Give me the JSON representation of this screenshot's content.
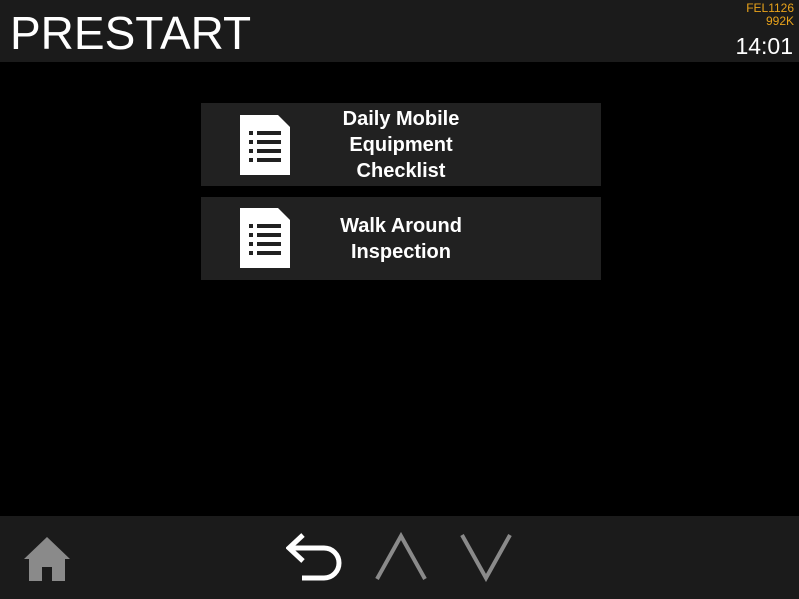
{
  "header": {
    "title": "PRESTART",
    "unit_id": "FEL1126",
    "unit_code": "992K",
    "time": "14:01"
  },
  "menu": {
    "items": [
      {
        "label_lines": [
          "Daily Mobile",
          "Equipment",
          "Checklist"
        ],
        "icon": "document-list-icon"
      },
      {
        "label_lines": [
          "Walk Around",
          "Inspection"
        ],
        "icon": "document-list-icon"
      }
    ]
  },
  "footer": {
    "icons": [
      "home-icon",
      "back-icon",
      "up-arrow-icon",
      "down-arrow-icon"
    ]
  },
  "colors": {
    "background": "#000000",
    "bar": "#1b1b1b",
    "button": "#212121",
    "accent": "#e8a21a",
    "disabled": "#8a8a8a"
  }
}
